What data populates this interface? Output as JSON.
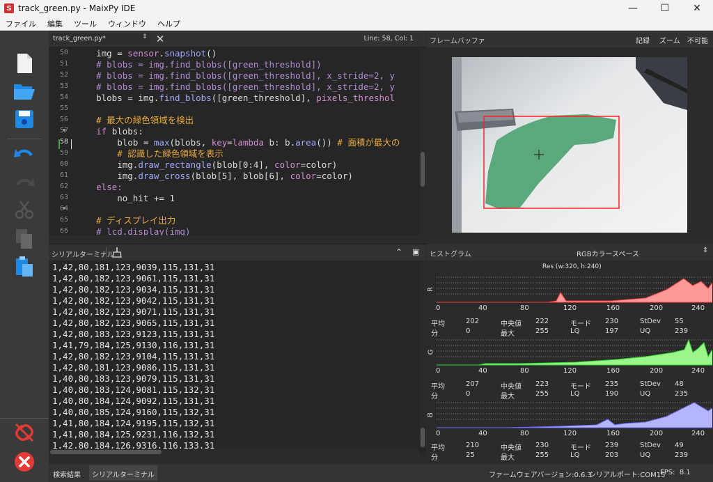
{
  "window": {
    "title": "track_green.py - MaixPy IDE",
    "icon_letter": "S"
  },
  "menu": [
    "ファイル",
    "編集",
    "ツール",
    "ウィンドウ",
    "ヘルプ"
  ],
  "editor": {
    "file": "track_green.py*",
    "position": "Line: 58, Col: 1",
    "line_numbers": [
      "50",
      "51",
      "52",
      "53",
      "54",
      "55",
      "56",
      "57",
      "58",
      "59",
      "60",
      "61",
      "62",
      "63",
      "64",
      "65",
      "66"
    ]
  },
  "code": {
    "l50a": "    img = ",
    "l50b": "sensor",
    "l50c": ".",
    "l50d": "snapshot",
    "l50e": "()",
    "l51": "    # blobs = img.find_blobs([green_threshold])",
    "l52": "    # blobs = img.find_blobs([green_threshold], x_stride=2, y",
    "l53": "    # blobs = img.find_blobs([green_threshold], x_stride=2, y",
    "l54a": "    blobs = img.",
    "l54b": "find_blobs",
    "l54c": "([green_threshold], ",
    "l54d": "pixels_threshol",
    "l56": "    # 最大の緑色領域を検出",
    "l57a": "    ",
    "l57b": "if",
    "l57c": " blobs:",
    "l58a": "        blob = ",
    "l58b": "max",
    "l58c": "(blobs, ",
    "l58d": "key",
    "l58e": "=",
    "l58f": "lambda",
    "l58g": " b: b.",
    "l58h": "area",
    "l58i": "()) ",
    "l58j": "# 面積が最大の",
    "l59": "        # 認識した緑色領域を表示",
    "l60a": "        img.",
    "l60b": "draw_rectangle",
    "l60c": "(blob[0:4], ",
    "l60d": "color",
    "l60e": "=color)",
    "l61a": "        img.",
    "l61b": "draw_cross",
    "l61c": "(blob[5], blob[6], ",
    "l61d": "color",
    "l61e": "=color)",
    "l62": "    else:",
    "l63": "        no_hit += 1",
    "l65": "    # ディスプレイ出力",
    "l66": "    # lcd.display(img)"
  },
  "framebuffer": {
    "title": "フレームバッファ",
    "record": "記録",
    "zoom": "ズーム",
    "disable": "不可能"
  },
  "serial": {
    "title": "シリアルターミナル",
    "lines": [
      "1,42,80,181,123,9039,115,131,31",
      "1,42,80,182,123,9061,115,131,31",
      "1,42,80,182,123,9034,115,131,31",
      "1,42,80,182,123,9042,115,131,31",
      "1,42,80,182,123,9071,115,131,31",
      "1,42,80,182,123,9065,115,131,31",
      "1,42,80,183,123,9123,115,131,31",
      "1,41,79,184,125,9130,116,131,31",
      "1,42,80,182,123,9104,115,131,31",
      "1,42,80,181,123,9086,115,131,31",
      "1,40,80,183,123,9079,115,131,31",
      "1,40,80,183,124,9081,115,132,31",
      "1,40,80,184,124,9092,115,131,31",
      "1,40,80,185,124,9160,115,132,31",
      "1,41,80,184,124,9195,115,132,31",
      "1,41,80,184,125,9231,116,132,31",
      "1,42,80,184,126,9316,116,133,31"
    ]
  },
  "histogram": {
    "title": "ヒストグラム",
    "colorspace": "RGBカラースペース",
    "resolution": "Res (w:320, h:240)",
    "ticks": [
      "0",
      "40",
      "80",
      "120",
      "160",
      "200",
      "240"
    ],
    "labels": {
      "mean": "平均",
      "median": "中央値",
      "mode": "モード",
      "stdev": "StDev",
      "min": "分",
      "max": "最大",
      "lq": "LQ",
      "uq": "UQ"
    },
    "channels": [
      {
        "name": "R",
        "color": "#ff9a9a",
        "line": "#ff3c3c",
        "mean": "202",
        "median": "222",
        "mode": "230",
        "stdev": "55",
        "min": "0",
        "max": "255",
        "lq": "197",
        "uq": "239"
      },
      {
        "name": "G",
        "color": "#9af58a",
        "line": "#2ed82e",
        "mean": "207",
        "median": "223",
        "mode": "235",
        "stdev": "48",
        "min": "0",
        "max": "255",
        "lq": "190",
        "uq": "235"
      },
      {
        "name": "B",
        "color": "#b4b4ff",
        "line": "#6e6eff",
        "mean": "210",
        "median": "230",
        "mode": "239",
        "stdev": "49",
        "min": "25",
        "max": "255",
        "lq": "203",
        "uq": "239"
      }
    ]
  },
  "statusbar": {
    "search_results": "検索結果",
    "serial_terminal": "シリアルターミナル",
    "firmware": "ファームウェアバージョン:0.6.3",
    "port": "シリアルポート:COM15",
    "fps": "FPS:  8.1"
  },
  "colors": {
    "accent_blue": "#1e88e5",
    "disconnect_red": "#e53935",
    "bbox": "#ff2020",
    "blob": "#5aa87c"
  }
}
